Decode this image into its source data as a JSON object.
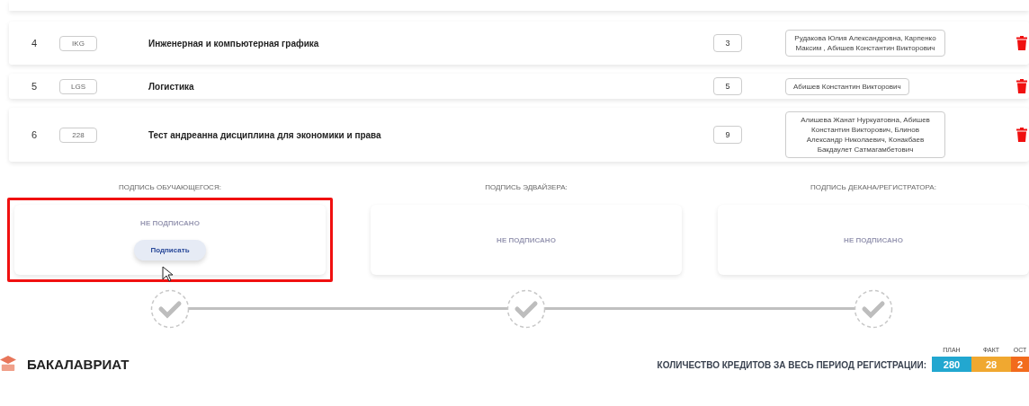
{
  "disciplines": [
    {
      "number": "4",
      "code": "IKG",
      "name": "Инженерная и компьютерная графика",
      "credits": "3",
      "teachers": "Рудакова Юлия Александровна, Карпенко Максим , Абишев Константин Викторович"
    },
    {
      "number": "5",
      "code": "LGS",
      "name": "Логистика",
      "credits": "5",
      "teachers": "Абишев Константин Викторович"
    },
    {
      "number": "6",
      "code": "228",
      "name": "Тест андреанна дисциплина для экономики и права",
      "credits": "9",
      "teachers": "Алишева Жанат Нуркуатовна, Абишев Константин Викторович, Блинов Александр Николаевич, Конакбаев Бакдаулет Сатмагамбетович"
    }
  ],
  "signatures": [
    {
      "label": "ПОДПИСЬ ОБУЧАЮЩЕГОСЯ:",
      "status": "НЕ ПОДПИСАНО",
      "button": "Подписать",
      "highlighted": true
    },
    {
      "label": "ПОДПИСЬ ЭДВАЙЗЕРА:",
      "status": "НЕ ПОДПИСАНО",
      "highlighted": false
    },
    {
      "label": "ПОДПИСЬ ДЕКАНА/РЕГИСТРАТОРА:",
      "status": "НЕ ПОДПИСАНО",
      "highlighted": false
    }
  ],
  "program": {
    "title": "БАКАЛАВРИАТ"
  },
  "credits": {
    "label": "КОЛИЧЕСТВО КРЕДИТОВ ЗА ВЕСЬ ПЕРИОД РЕГИСТРАЦИИ:",
    "items": [
      {
        "caption": "ПЛАН",
        "value": "280",
        "color": "#22a7d0"
      },
      {
        "caption": "ФАКТ",
        "value": "28",
        "color": "#f0a830"
      },
      {
        "caption": "ОСТ",
        "value": "2",
        "color": "#f26b1d"
      }
    ]
  }
}
